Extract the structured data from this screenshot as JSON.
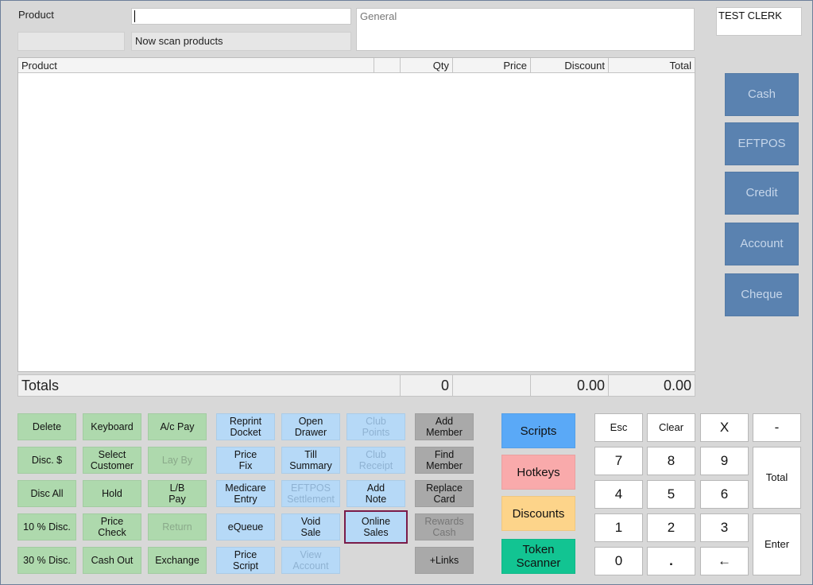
{
  "header": {
    "product_label": "Product",
    "product_value": "",
    "status_text": "Now scan products",
    "general_label": "General",
    "clerk": "TEST CLERK"
  },
  "table": {
    "columns": [
      "Product",
      "",
      "Qty",
      "Price",
      "Discount",
      "Total"
    ]
  },
  "totals": {
    "label": "Totals",
    "qty": "0",
    "price": "",
    "discount": "0.00",
    "total": "0.00"
  },
  "payments": [
    "Cash",
    "EFTPOS",
    "Credit",
    "Account",
    "Cheque"
  ],
  "functions": {
    "col1": [
      "Delete",
      "Disc. $",
      "Disc All",
      "10 % Disc.",
      "30 % Disc."
    ],
    "col2": [
      "Keyboard",
      "Select\nCustomer",
      "Hold",
      "Price\nCheck",
      "Cash Out"
    ],
    "col3": [
      "A/c Pay",
      "Lay By",
      "L/B\nPay",
      "Return",
      "Exchange"
    ],
    "col4": [
      "Reprint\nDocket",
      "Price\nFix",
      "Medicare\nEntry",
      "eQueue",
      "Price\nScript"
    ],
    "col5": [
      "Open\nDrawer",
      "Till\nSummary",
      "EFTPOS\nSettlement",
      "Void\nSale",
      "View\nAccount"
    ],
    "col6": [
      "Club\nPoints",
      "Club\nReceipt",
      "Add\nNote",
      "Online\nSales"
    ],
    "col7": [
      "Add\nMember",
      "Find\nMember",
      "Replace\nCard",
      "Rewards\nCash",
      "+Links"
    ]
  },
  "menus": {
    "scripts": "Scripts",
    "hotkeys": "Hotkeys",
    "discounts": "Discounts",
    "token_scanner": "Token\nScanner"
  },
  "colors": {
    "scripts": "#5aa9f7",
    "hotkeys": "#f9aaab",
    "discounts": "#fdd48a",
    "token_scanner": "#12c492",
    "selected_outline": "#7a1c49"
  },
  "keypad": {
    "esc": "Esc",
    "clear": "Clear",
    "multiply": "X",
    "minus": "-",
    "seven": "7",
    "eight": "8",
    "nine": "9",
    "total": "Total",
    "four": "4",
    "five": "5",
    "six": "6",
    "one": "1",
    "two": "2",
    "three": "3",
    "enter": "Enter",
    "zero": "0",
    "dot": ".",
    "back": "←"
  }
}
